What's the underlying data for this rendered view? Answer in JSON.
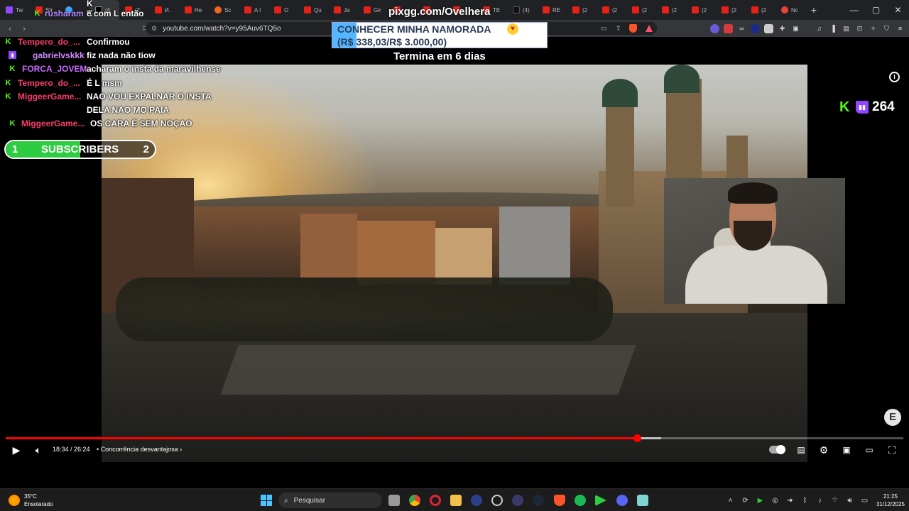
{
  "browser": {
    "tabs": [
      {
        "label": "Tw",
        "icon": "twitch-icon"
      },
      {
        "label": "Str",
        "icon": "youtube-icon"
      },
      {
        "label": "",
        "icon": "speaker-icon"
      },
      {
        "label": "(4",
        "icon": "x-icon"
      },
      {
        "label": "(2",
        "icon": "youtube-icon"
      },
      {
        "label": "И.",
        "icon": "youtube-icon"
      },
      {
        "label": "He",
        "icon": "youtube-icon"
      },
      {
        "label": "Sc",
        "icon": "orange-icon"
      },
      {
        "label": "A I",
        "icon": "youtube-icon"
      },
      {
        "label": "O",
        "icon": "youtube-icon"
      },
      {
        "label": "Qu",
        "icon": "youtube-icon"
      },
      {
        "label": "Ja",
        "icon": "youtube-icon"
      },
      {
        "label": "Gir",
        "icon": "youtube-icon"
      },
      {
        "label": "",
        "icon": "youtube-icon"
      },
      {
        "label": "",
        "icon": "youtube-icon"
      },
      {
        "label": "",
        "icon": "youtube-icon"
      },
      {
        "label": "TE",
        "icon": "youtube-icon"
      },
      {
        "label": "(4)",
        "icon": "tiktok-icon"
      },
      {
        "label": "RE",
        "icon": "youtube-icon"
      },
      {
        "label": "(2",
        "icon": "youtube-icon"
      },
      {
        "label": "(2",
        "icon": "youtube-icon"
      },
      {
        "label": "(2",
        "icon": "youtube-icon"
      },
      {
        "label": "(2",
        "icon": "youtube-icon"
      },
      {
        "label": "(2",
        "icon": "youtube-icon"
      },
      {
        "label": "(2",
        "icon": "youtube-icon"
      },
      {
        "label": "(2",
        "icon": "youtube-icon"
      },
      {
        "label": "Nc",
        "icon": "chrome-icon"
      }
    ],
    "new_tab": "+",
    "url": "youtube.com/watch?v=y95Auv6TQ5o",
    "window_controls": {
      "minimize": "—",
      "maximize": "▢",
      "close": "✕"
    }
  },
  "chat": {
    "messages": [
      {
        "user": "rusharam",
        "text": "é com L então",
        "color": "#b388ff",
        "badge": "kick-icon"
      },
      {
        "user": "Tempero_do_...",
        "text": "Confirmou",
        "color": "#ff3d6e",
        "badge": "kick-icon"
      },
      {
        "user": "gabrielvskkk",
        "text": "fiz nada não tiow",
        "color": "#d08bff",
        "badge": "twitch-icon"
      },
      {
        "user": "FORCA_JOVEM",
        "text": "acharam o insta da maravilhense",
        "color": "#c86bff",
        "badge": "kick-icon"
      },
      {
        "user": "Tempero_do_...",
        "text": "É L msm",
        "color": "#ff3d6e",
        "badge": "kick-icon"
      },
      {
        "user": "MiggeerGame...",
        "text": "NAO VOU EXPALNAR O INSTA",
        "color": "#ff3d6e",
        "badge": "kick-icon"
      },
      {
        "user": "",
        "text": "DELA NAO MO PAIA",
        "color": "#ff3d6e",
        "badge": ""
      },
      {
        "user": "MiggeerGame...",
        "text": "OS CARA É SEM NOÇAO",
        "color": "#ff3d6e",
        "badge": "kick-icon"
      }
    ],
    "partial_top": [
      {
        "user": "",
        "text": "K",
        "color": "#ff3d6e"
      },
      {
        "user": "",
        "text": "K",
        "color": "#ff3d6e"
      }
    ]
  },
  "overlay": {
    "pix_url": "pixgg.com/Ovelhera",
    "goal_title": "CONHECER MINHA NAMORADA",
    "goal_amount": "(R$ 338,03/R$ 3.000,00)",
    "goal_progress": 0.113,
    "goal_ends": "Termina em 6 dias",
    "subs_left": "1",
    "subs_label": "SUBSCRIBERS",
    "subs_right": "2",
    "subs_progress": 0.5,
    "viewer_count": "264"
  },
  "player": {
    "current_time": "18:34",
    "duration": "26:24",
    "time_text": "18:34 / 26:24",
    "chapter": "• Concorrência desvantajosa",
    "played_fraction": 0.703,
    "buffered_fraction": 0.73
  },
  "taskbar": {
    "temperature": "35°C",
    "condition": "Ensolarado",
    "search_placeholder": "Pesquisar",
    "time": "21:25",
    "date": "31/12/2025"
  }
}
